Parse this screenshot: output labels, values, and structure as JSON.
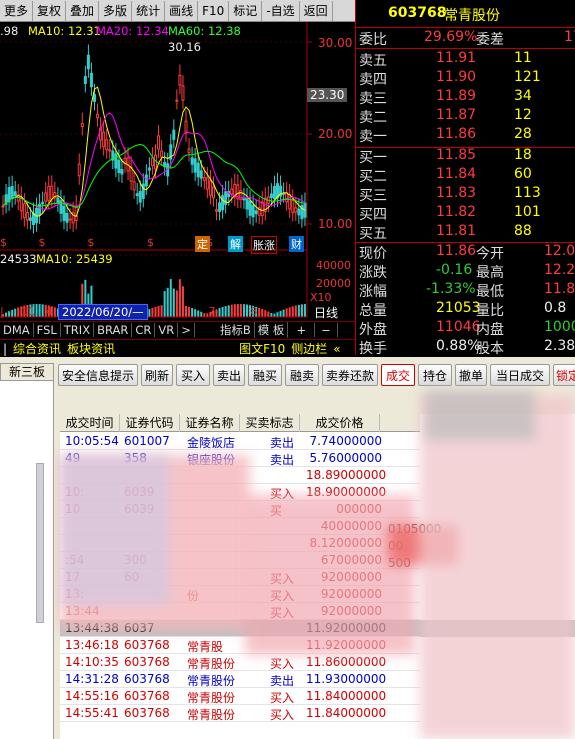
{
  "toolbar": {
    "items": [
      "更多",
      "复权",
      "叠加",
      "多版",
      "统计",
      "画线",
      "F10",
      "标记",
      "-自选",
      "返回"
    ]
  },
  "chart": {
    "ma5_frag": ".98",
    "ma10": "MA10: 12.31",
    "ma20": "MA20: 12.34",
    "ma60": "MA60: 12.38",
    "price_labels": [
      "30.00",
      "20.00",
      "10.00"
    ],
    "peak_label": "30.16",
    "current_label": "23.30",
    "vol_ma5_frag": "24533",
    "vol_ma10": "MA10: 25439",
    "vol_labels": [
      "40000",
      "20000",
      "X10"
    ],
    "axis_date": "2022/06/20/—",
    "axis_ticks": [
      "11",
      "4",
      "7",
      "8"
    ],
    "period": "日线",
    "event_marks": [
      "定",
      "解",
      "胀涨",
      "财"
    ]
  },
  "indicator_tabs": [
    "DMA",
    "FSL",
    "TRIX",
    "BRAR",
    "CR",
    "VR",
    ">",
    "指标B",
    "模 板",
    "+",
    "−"
  ],
  "bottom_tabs": [
    "综合资讯",
    "板块资讯",
    "图文F10",
    "侧边栏",
    "«"
  ],
  "quote": {
    "code": "603768",
    "name": "常青股份",
    "weibi_label": "委比",
    "weibi": "29.69%",
    "weicha_label": "委差",
    "weicha": "17",
    "asks": [
      {
        "label": "卖五",
        "price": "11.91",
        "vol": "11"
      },
      {
        "label": "卖四",
        "price": "11.90",
        "vol": "121"
      },
      {
        "label": "卖三",
        "price": "11.89",
        "vol": "34"
      },
      {
        "label": "卖二",
        "price": "11.87",
        "vol": "12"
      },
      {
        "label": "卖一",
        "price": "11.86",
        "vol": "28"
      }
    ],
    "bids": [
      {
        "label": "买一",
        "price": "11.85",
        "vol": "18"
      },
      {
        "label": "买二",
        "price": "11.84",
        "vol": "60"
      },
      {
        "label": "买三",
        "price": "11.83",
        "vol": "113"
      },
      {
        "label": "买四",
        "price": "11.82",
        "vol": "101"
      },
      {
        "label": "买五",
        "price": "11.81",
        "vol": "88"
      }
    ],
    "stats": [
      {
        "l1": "现价",
        "v1": "11.86",
        "l2": "今开",
        "v2": "12.0"
      },
      {
        "l1": "涨跌",
        "v1": "-0.16",
        "l2": "最高",
        "v2": "12.2"
      },
      {
        "l1": "涨幅",
        "v1": "-1.33%",
        "l2": "最低",
        "v2": "11.8"
      },
      {
        "l1": "总量",
        "v1": "21053",
        "l2": "量比",
        "v2": "0.8"
      },
      {
        "l1": "外盘",
        "v1": "11046",
        "l2": "内盘",
        "v2": "1000"
      },
      {
        "l1": "换手",
        "v1": "0.88%",
        "l2": "股本",
        "v2": "2.38-"
      }
    ]
  },
  "trade": {
    "left_tab": "新三板",
    "buttons": [
      "安全信息提示",
      "刷新",
      "买入",
      "卖出",
      "融买",
      "融卖",
      "卖券还款",
      "成交",
      "持仓",
      "撤单",
      "当日成交",
      "锁定"
    ],
    "columns": [
      "成交时间",
      "证券代码",
      "证券名称",
      "买卖标志",
      "成交价格"
    ],
    "rows": [
      {
        "time": "10:05:54",
        "code": "601007",
        "name": "金陵饭店",
        "side": "卖出",
        "price": "7.74000000"
      },
      {
        "time": "49",
        "code": "358",
        "name": "银座股份",
        "side": "卖出",
        "price": "5.76000000"
      },
      {
        "time": "",
        "code": "",
        "name": "",
        "side": "",
        "price": "18.89000000"
      },
      {
        "time": "10:",
        "code": "6039",
        "name": "",
        "side": "买入",
        "price": "18.90000000"
      },
      {
        "time": "10",
        "code": "6039",
        "name": "",
        "side": "买",
        "price": "000000"
      },
      {
        "time": "",
        "code": "",
        "name": "",
        "side": "",
        "price": "40000000"
      },
      {
        "time": "",
        "code": "",
        "name": "",
        "side": "",
        "price": "8.12000000"
      },
      {
        "time": ":54",
        "code": "300",
        "name": "",
        "side": "",
        "price": "67000000"
      },
      {
        "time": "17",
        "code": "60",
        "name": "",
        "side": "买入",
        "price": "92000000"
      },
      {
        "time": "13:",
        "code": "",
        "name": "份",
        "side": "买入",
        "price": "92000000"
      },
      {
        "time": "13:44",
        "code": "",
        "name": "",
        "side": "买入",
        "price": "92000000"
      },
      {
        "time": "13:44:38",
        "code": "6037",
        "name": "",
        "side": "",
        "price": "11.92000000"
      },
      {
        "time": "13:46:18",
        "code": "603768",
        "name": "常青股",
        "side": "",
        "price": "11.92000000"
      },
      {
        "time": "14:10:35",
        "code": "603768",
        "name": "常青股份",
        "side": "买入",
        "price": "11.86000000"
      },
      {
        "time": "14:31:28",
        "code": "603768",
        "name": "常青股份",
        "side": "卖出",
        "price": "11.93000000"
      },
      {
        "time": "14:55:16",
        "code": "603768",
        "name": "常青股份",
        "side": "买入",
        "price": "11.84000000"
      },
      {
        "time": "14:55:41",
        "code": "603768",
        "name": "常青股份",
        "side": "买入",
        "price": "11.84000000"
      }
    ],
    "side_colors": {
      "buy": "#d00000",
      "sell": "#0000cc"
    },
    "extra_col": [
      "0105000",
      "00",
      "500"
    ]
  }
}
